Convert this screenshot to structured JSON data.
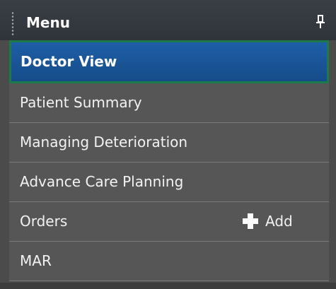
{
  "menu": {
    "title": "Menu",
    "grip_icon": "grip-dots-icon",
    "pin_icon": "pin-icon",
    "items": [
      {
        "label": "Doctor View",
        "active": true
      },
      {
        "label": "Patient Summary"
      },
      {
        "label": "Managing Deterioration"
      },
      {
        "label": "Advance Care Planning"
      },
      {
        "label": "Orders",
        "action": {
          "label": "Add",
          "icon": "plus-icon"
        }
      },
      {
        "label": "MAR"
      }
    ]
  },
  "colors": {
    "header_bg": "#33383f",
    "active_bg": "#1c5aa0",
    "active_border": "#1d7a4a",
    "item_bg": "#565656",
    "divider": "#7a7a7a"
  }
}
